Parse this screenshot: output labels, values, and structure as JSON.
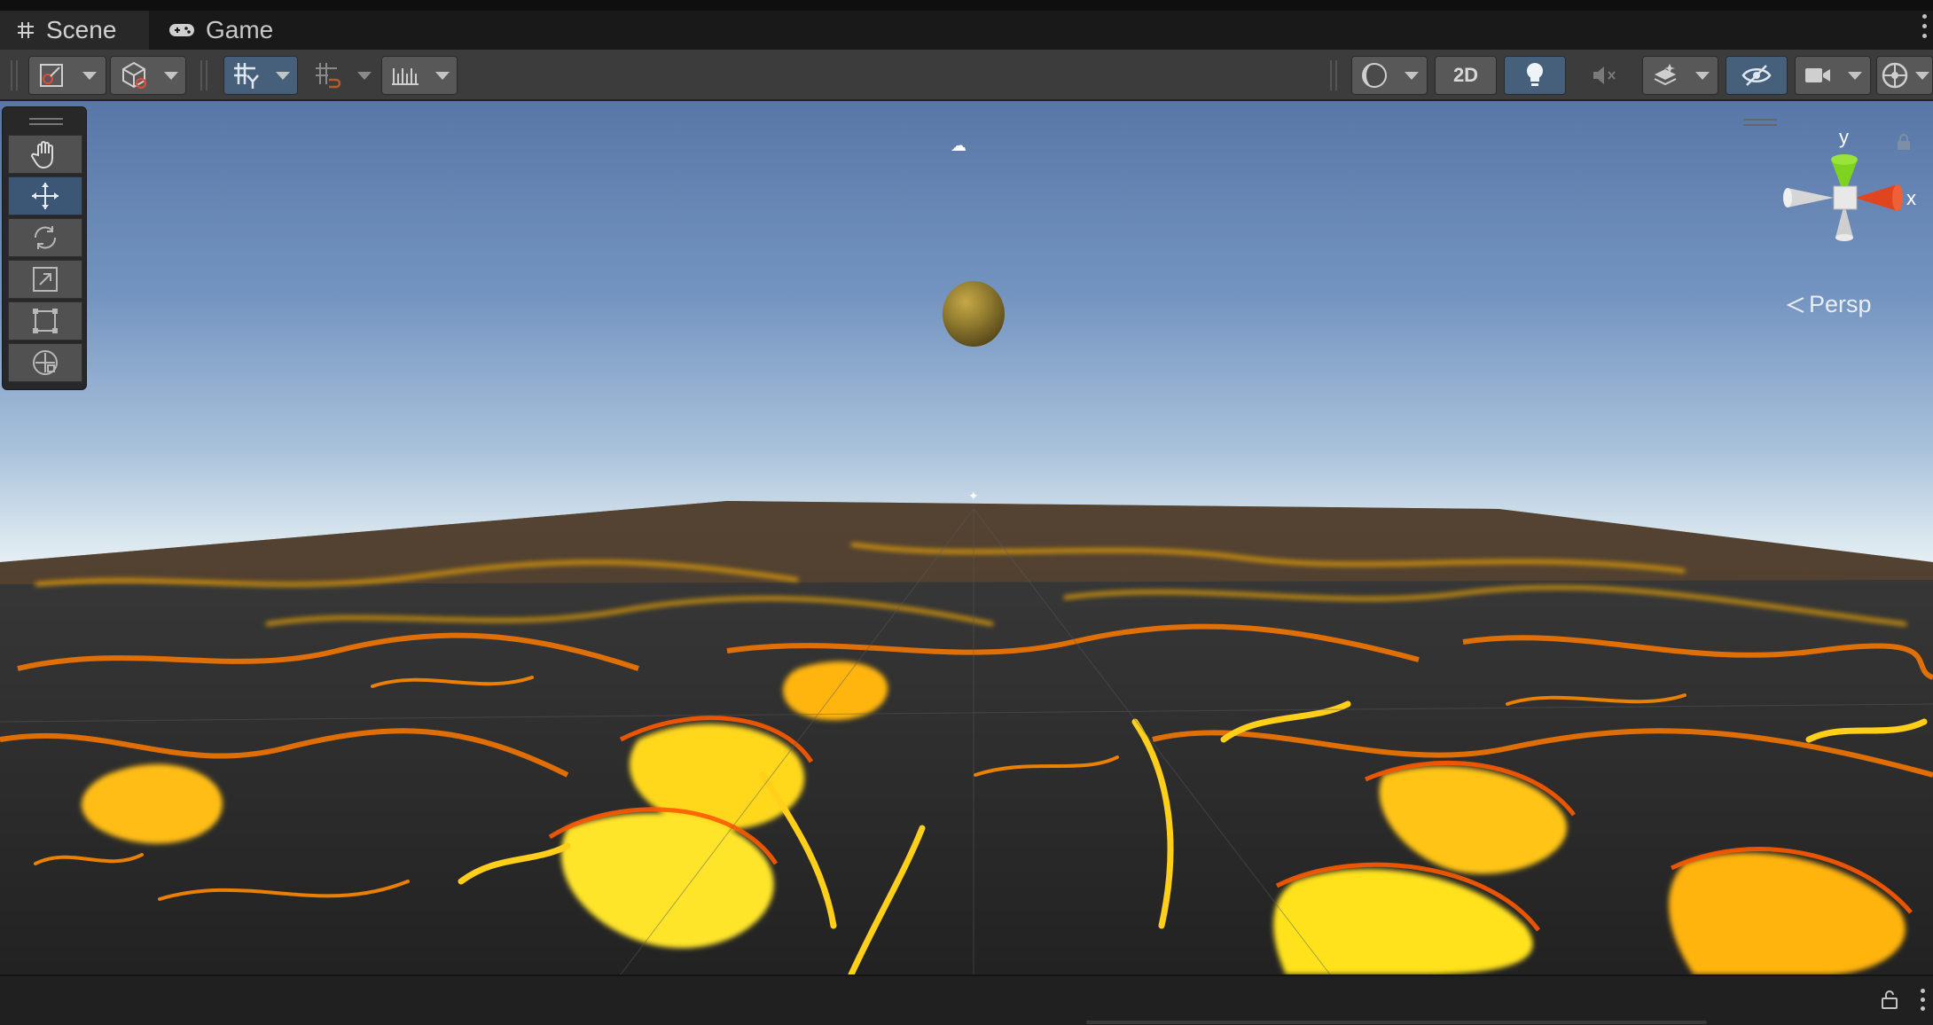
{
  "tabs": {
    "scene": {
      "label": "Scene",
      "icon": "grid-icon",
      "active": true
    },
    "game": {
      "label": "Game",
      "icon": "gamepad-icon",
      "active": false
    }
  },
  "toolbar": {
    "draw_mode_icon": "draw-mode-icon",
    "render_mode_icon": "cube-icon",
    "grid_snap_icon": "grid-snap-icon",
    "increment_snap_icon": "increment-snap-icon",
    "ruler_icon": "ruler-icon",
    "shading_icon": "shading-sphere-icon",
    "mode_2d_label": "2D",
    "lighting_icon": "lightbulb-icon",
    "audio_icon": "audio-mute-icon",
    "effects_icon": "effects-layers-icon",
    "visibility_icon": "eye-slash-icon",
    "camera_icon": "camera-icon",
    "gizmos_icon": "gizmos-globe-icon"
  },
  "tools": [
    {
      "name": "hand-tool",
      "icon": "hand-icon",
      "selected": false
    },
    {
      "name": "move-tool",
      "icon": "move-arrows-icon",
      "selected": true
    },
    {
      "name": "rotate-tool",
      "icon": "rotate-icon",
      "selected": false
    },
    {
      "name": "scale-tool",
      "icon": "scale-icon",
      "selected": false
    },
    {
      "name": "rect-tool",
      "icon": "rect-transform-icon",
      "selected": false
    },
    {
      "name": "transform-tool",
      "icon": "transform-icon",
      "selected": false
    }
  ],
  "gizmo": {
    "y_label": "y",
    "x_label": "x",
    "projection_label": "Persp",
    "colors": {
      "y": "#7ed321",
      "x": "#e0451f",
      "neutral": "#d6d6d6"
    }
  },
  "scene": {
    "sky_colors": [
      "#5877a6",
      "#eef4f6"
    ],
    "lava_colors": [
      "#ffe81a",
      "#ff8c00",
      "#c53b00",
      "#2a2a2a"
    ],
    "sphere_color": "#8f7a2e"
  }
}
